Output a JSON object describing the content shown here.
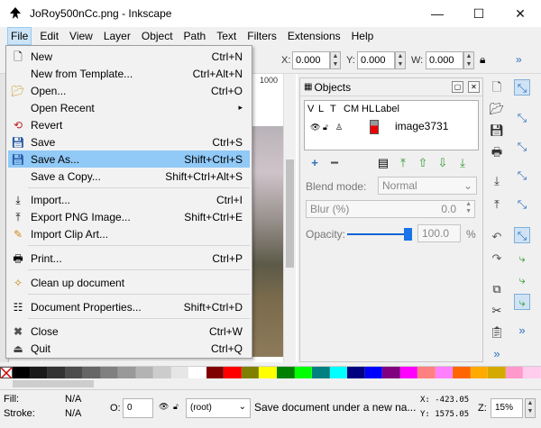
{
  "window": {
    "title": "JoRoy500nCc.png - Inkscape"
  },
  "menubar": [
    {
      "label": "File"
    },
    {
      "label": "Edit"
    },
    {
      "label": "View"
    },
    {
      "label": "Layer"
    },
    {
      "label": "Object"
    },
    {
      "label": "Path"
    },
    {
      "label": "Text"
    },
    {
      "label": "Filters"
    },
    {
      "label": "Extensions"
    },
    {
      "label": "Help"
    }
  ],
  "toolbar": {
    "x_label": "X:",
    "x_value": "0.000",
    "y_label": "Y:",
    "y_value": "0.000",
    "w_label": "W:",
    "w_value": "0.000"
  },
  "file_menu": [
    {
      "label": "New",
      "shortcut": "Ctrl+N",
      "icon": "new-document-icon"
    },
    {
      "label": "New from Template...",
      "shortcut": "Ctrl+Alt+N",
      "icon": ""
    },
    {
      "label": "Open...",
      "shortcut": "Ctrl+O",
      "icon": "open-folder-icon"
    },
    {
      "label": "Open Recent",
      "shortcut": "▸",
      "icon": ""
    },
    {
      "label": "Revert",
      "shortcut": "",
      "icon": "revert-icon"
    },
    {
      "label": "Save",
      "shortcut": "Ctrl+S",
      "icon": "save-icon"
    },
    {
      "label": "Save As...",
      "shortcut": "Shift+Ctrl+S",
      "icon": "save-as-icon"
    },
    {
      "label": "Save a Copy...",
      "shortcut": "Shift+Ctrl+Alt+S",
      "icon": ""
    },
    {
      "label": "Import...",
      "shortcut": "Ctrl+I",
      "icon": "import-icon"
    },
    {
      "label": "Export PNG Image...",
      "shortcut": "Shift+Ctrl+E",
      "icon": "export-icon"
    },
    {
      "label": "Import Clip Art...",
      "shortcut": "",
      "icon": "clipart-icon"
    },
    {
      "label": "Print...",
      "shortcut": "Ctrl+P",
      "icon": "print-icon"
    },
    {
      "label": "Clean up document",
      "shortcut": "",
      "icon": "cleanup-icon"
    },
    {
      "label": "Document Properties...",
      "shortcut": "Shift+Ctrl+D",
      "icon": "properties-icon"
    },
    {
      "label": "Close",
      "shortcut": "Ctrl+W",
      "icon": "close-icon"
    },
    {
      "label": "Quit",
      "shortcut": "Ctrl+Q",
      "icon": "quit-icon"
    }
  ],
  "objects_panel": {
    "title": "Objects",
    "columns": [
      "V",
      "L",
      "T",
      "CM",
      "HL",
      "Label"
    ],
    "row_label": "image3731",
    "blend_label": "Blend mode:",
    "blend_value": "Normal",
    "blur_label": "Blur (%)",
    "blur_value": "0.0",
    "opacity_label": "Opacity:",
    "opacity_value": "100.0",
    "opacity_unit": "%",
    "opacity_level": 1.0
  },
  "ruler_text": "1000",
  "statusbar": {
    "fill_label": "Fill:",
    "fill_value": "N/A",
    "stroke_label": "Stroke:",
    "stroke_value": "N/A",
    "o_label": "O:",
    "o_value": "0",
    "layer_value": "(root)",
    "message": "Save document under a new na...",
    "x_coord": "X: -423.05",
    "y_coord": "Y: 1575.05",
    "z_label": "Z:",
    "zoom": "15%"
  },
  "palette_colors": [
    "#000000",
    "#1a1a1a",
    "#333333",
    "#4d4d4d",
    "#666666",
    "#808080",
    "#999999",
    "#b3b3b3",
    "#cccccc",
    "#e6e6e6",
    "#ffffff",
    "#800000",
    "#ff0000",
    "#808000",
    "#ffff00",
    "#008000",
    "#00ff00",
    "#008080",
    "#00ffff",
    "#000080",
    "#0000ff",
    "#800080",
    "#ff00ff",
    "#ff8080",
    "#ff80ff",
    "#ff6600",
    "#ffaa00",
    "#d4aa00",
    "#ff99cc",
    "#ffccee"
  ]
}
